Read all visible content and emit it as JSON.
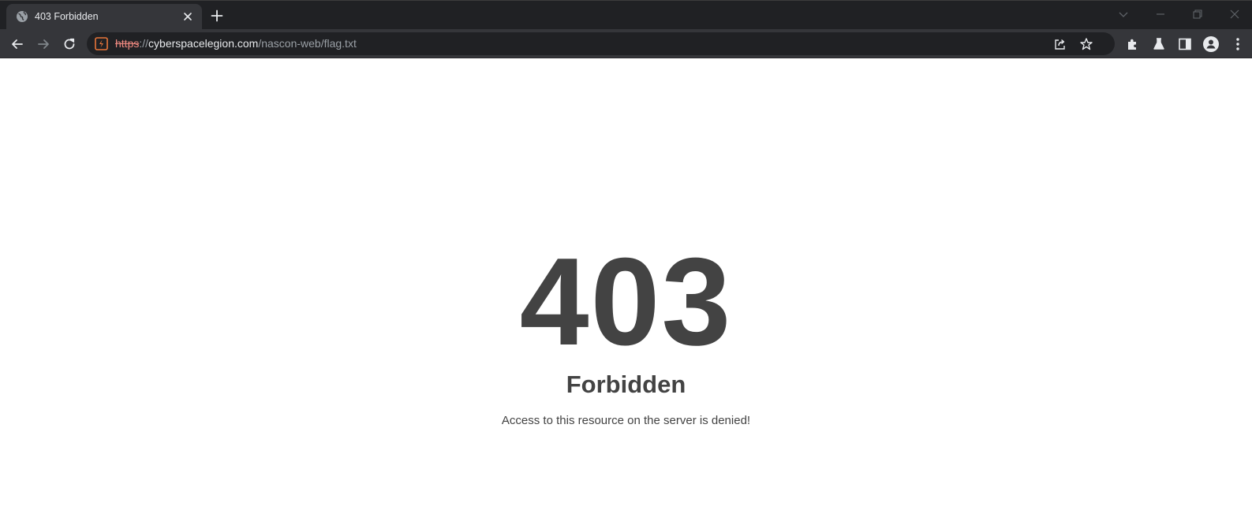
{
  "tab": {
    "title": "403 Forbidden"
  },
  "address_bar": {
    "scheme": "https",
    "separator": "://",
    "host": "cyberspacelegion.com",
    "path": "/nascon-web/flag.txt"
  },
  "icons": {
    "tab_favicon": "globe-icon",
    "tab_close": "close-icon",
    "new_tab": "plus-icon",
    "tab_search": "chevron-down-icon",
    "minimize": "minimize-icon",
    "restore": "restore-icon",
    "close_window": "close-window-icon",
    "back": "arrow-left-icon",
    "forward": "arrow-right-icon",
    "reload": "reload-icon",
    "site_info": "not-secure-icon",
    "share": "share-icon",
    "bookmark": "star-icon",
    "extensions": "puzzle-icon",
    "labs": "flask-icon",
    "side_panel": "side-panel-icon",
    "profile": "profile-icon",
    "menu": "kebab-menu-icon"
  },
  "colors": {
    "tabstrip_bg": "#202124",
    "toolbar_bg": "#35363a",
    "not_secure_scheme": "#f28b82",
    "site_icon_accent": "#e8763a",
    "error_text": "#434343"
  },
  "page": {
    "code": "403",
    "title": "Forbidden",
    "message": "Access to this resource on the server is denied!"
  }
}
